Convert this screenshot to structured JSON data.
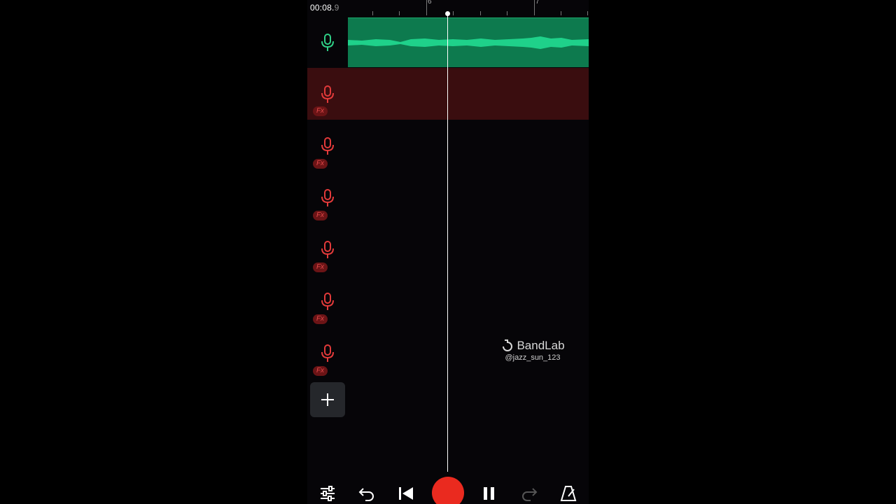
{
  "header": {
    "time_main": "00:08.",
    "time_frac": "9",
    "bar_numbers": [
      "6",
      "7"
    ]
  },
  "tracks": [
    {
      "type": "voice",
      "color": "#2fcf86",
      "has_region": true,
      "has_fx": false,
      "selected": false
    },
    {
      "type": "voice",
      "color": "#e23a3a",
      "has_region": false,
      "has_fx": true,
      "fx_label": "Fx",
      "selected": true
    },
    {
      "type": "voice",
      "color": "#e23a3a",
      "has_region": false,
      "has_fx": true,
      "fx_label": "Fx",
      "selected": false
    },
    {
      "type": "voice",
      "color": "#e23a3a",
      "has_region": false,
      "has_fx": true,
      "fx_label": "Fx",
      "selected": false
    },
    {
      "type": "voice",
      "color": "#e23a3a",
      "has_region": false,
      "has_fx": true,
      "fx_label": "Fx",
      "selected": false
    },
    {
      "type": "voice",
      "color": "#e23a3a",
      "has_region": false,
      "has_fx": true,
      "fx_label": "Fx",
      "selected": false
    },
    {
      "type": "voice",
      "color": "#e23a3a",
      "has_region": false,
      "has_fx": true,
      "fx_label": "Fx",
      "selected": false
    }
  ],
  "watermark": {
    "brand": "BandLab",
    "username": "@jazz_sun_123"
  },
  "toolbar": {
    "icons": [
      "mixer-icon",
      "undo-icon",
      "skip-to-start-icon",
      "record-button",
      "pause-icon",
      "redo-icon",
      "metronome-icon"
    ]
  },
  "colors": {
    "accent_green": "#0d7a4e",
    "waveform_green": "#1fd18a",
    "accent_red": "#e23a3a",
    "record_red": "#ea2a1f",
    "selected_lane": "#3a0d0f"
  }
}
